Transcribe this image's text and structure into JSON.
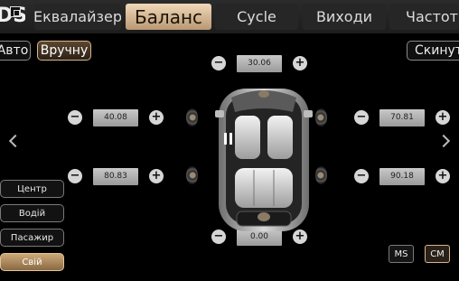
{
  "header": {
    "logo_text": "DSP",
    "tabs": [
      {
        "label": "Еквалайзер",
        "active": false
      },
      {
        "label": "Баланс",
        "active": true
      },
      {
        "label": "Cycle",
        "active": false
      },
      {
        "label": "Виходи",
        "active": false
      },
      {
        "label": "Частота",
        "active": false
      }
    ]
  },
  "mode": {
    "auto_label": "Авто",
    "manual_label": "Вручну",
    "reset_label": "Скинути",
    "selected": "Вручну"
  },
  "delays": {
    "top_center": "30.06",
    "front_left": "40.08",
    "front_right": "70.81",
    "rear_left": "80.83",
    "rear_right": "90.18",
    "bottom_center": "0.00"
  },
  "controls": {
    "minus_symbol": "−",
    "plus_symbol": "+"
  },
  "positions": {
    "items": [
      "Центр",
      "Водій",
      "Пасажир",
      "Свій"
    ],
    "selected": "Свій"
  },
  "units": {
    "ms_label": "MS",
    "cm_label": "CM",
    "selected": "CM"
  },
  "colors": {
    "accent": "#c9a57a",
    "value_bg": "#b0b0b0",
    "background": "#000000"
  },
  "icons": [
    "left-arrow-icon",
    "right-arrow-icon",
    "speaker-icon",
    "car-top-view-icon",
    "listening-position-icon"
  ]
}
